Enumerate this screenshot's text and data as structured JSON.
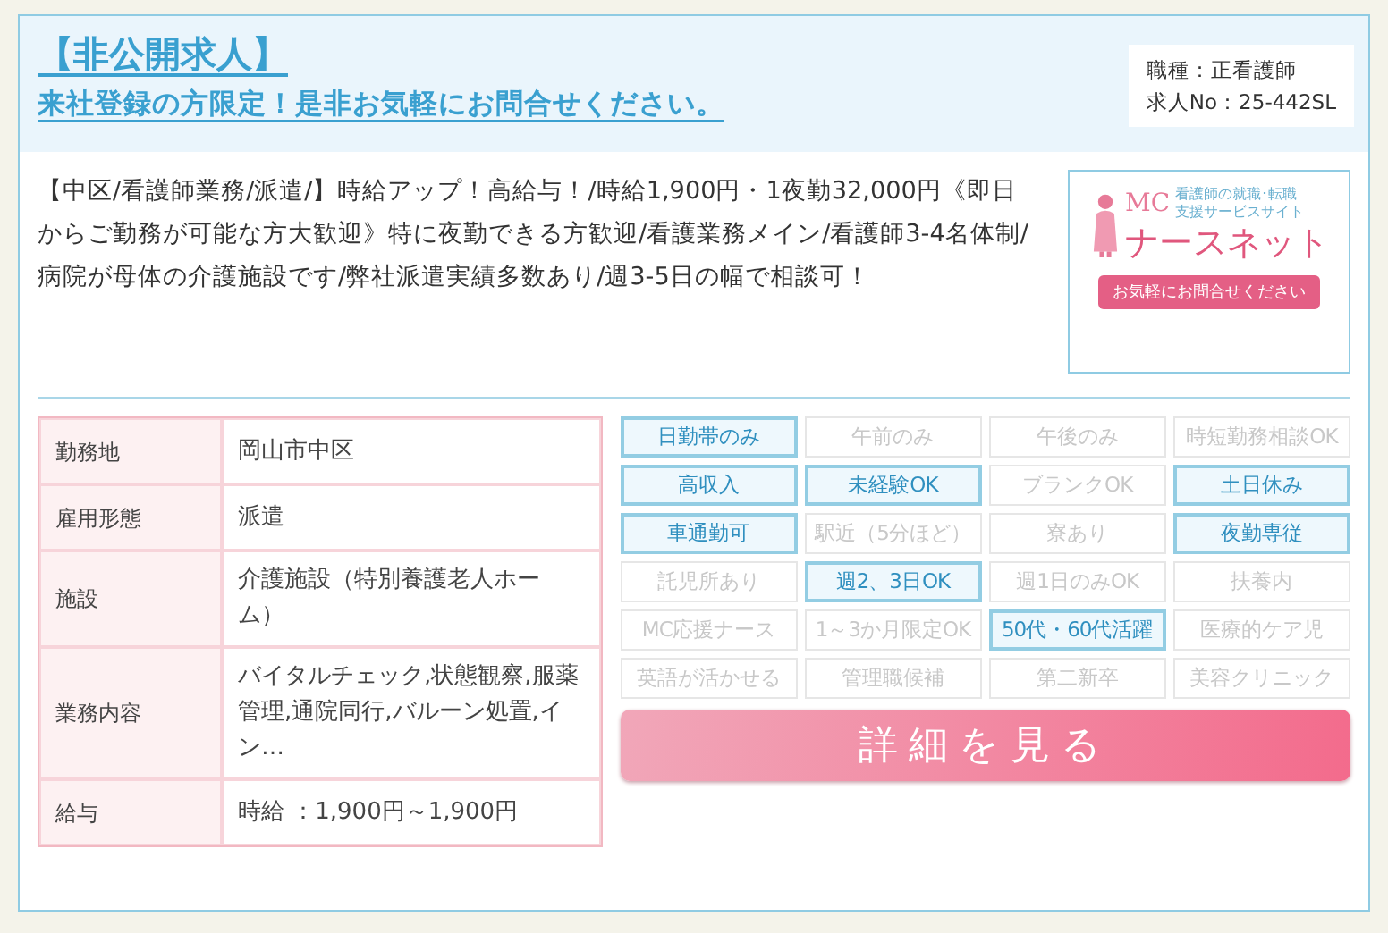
{
  "header": {
    "badge": "【非公開求人】",
    "link": "来社登録の方限定！是非お気軽にお問合せください。",
    "meta": [
      "職種：正看護師",
      "求人No：25-442SL"
    ]
  },
  "description": "【中区/看護師業務/派遣/】時給アップ！高給与！/時給1,900円・1夜勤32,000円《即日からご勤務が可能な方大歓迎》特に夜勤できる方歓迎/看護業務メイン/看護師3-4名体制/病院が母体の介護施設です/弊社派遣実績多数あり/週3-5日の幅で相談可！",
  "logo": {
    "mark": "MC",
    "tagline_1": "看護師の就職･転職",
    "tagline_2": "支援サービスサイト",
    "name": "ナースネット",
    "cta": "お気軽にお問合せください"
  },
  "details": [
    {
      "label": "勤務地",
      "value": "岡山市中区"
    },
    {
      "label": "雇用形態",
      "value": "派遣"
    },
    {
      "label": "施設",
      "value": "介護施設（特別養護老人ホーム）"
    },
    {
      "label": "業務内容",
      "value": "バイタルチェック,状態観察,服薬管理,通院同行,バルーン処置,イン…"
    },
    {
      "label": "給与",
      "value": "時給 ：1,900円～1,900円"
    }
  ],
  "tags": [
    {
      "label": "日勤帯のみ",
      "on": true
    },
    {
      "label": "午前のみ",
      "on": false
    },
    {
      "label": "午後のみ",
      "on": false
    },
    {
      "label": "時短勤務相談OK",
      "on": false
    },
    {
      "label": "高収入",
      "on": true
    },
    {
      "label": "未経験OK",
      "on": true
    },
    {
      "label": "ブランクOK",
      "on": false
    },
    {
      "label": "土日休み",
      "on": true
    },
    {
      "label": "車通勤可",
      "on": true
    },
    {
      "label": "駅近（5分ほど）",
      "on": false
    },
    {
      "label": "寮あり",
      "on": false
    },
    {
      "label": "夜勤専従",
      "on": true
    },
    {
      "label": "託児所あり",
      "on": false
    },
    {
      "label": "週2、3日OK",
      "on": true
    },
    {
      "label": "週1日のみOK",
      "on": false
    },
    {
      "label": "扶養内",
      "on": false
    },
    {
      "label": "MC応援ナース",
      "on": false
    },
    {
      "label": "1～3か月限定OK",
      "on": false
    },
    {
      "label": "50代・60代活躍",
      "on": true
    },
    {
      "label": "医療的ケア児",
      "on": false
    },
    {
      "label": "英語が活かせる",
      "on": false
    },
    {
      "label": "管理職候補",
      "on": false
    },
    {
      "label": "第二新卒",
      "on": false
    },
    {
      "label": "美容クリニック",
      "on": false
    }
  ],
  "detail_button": "詳細を見る"
}
